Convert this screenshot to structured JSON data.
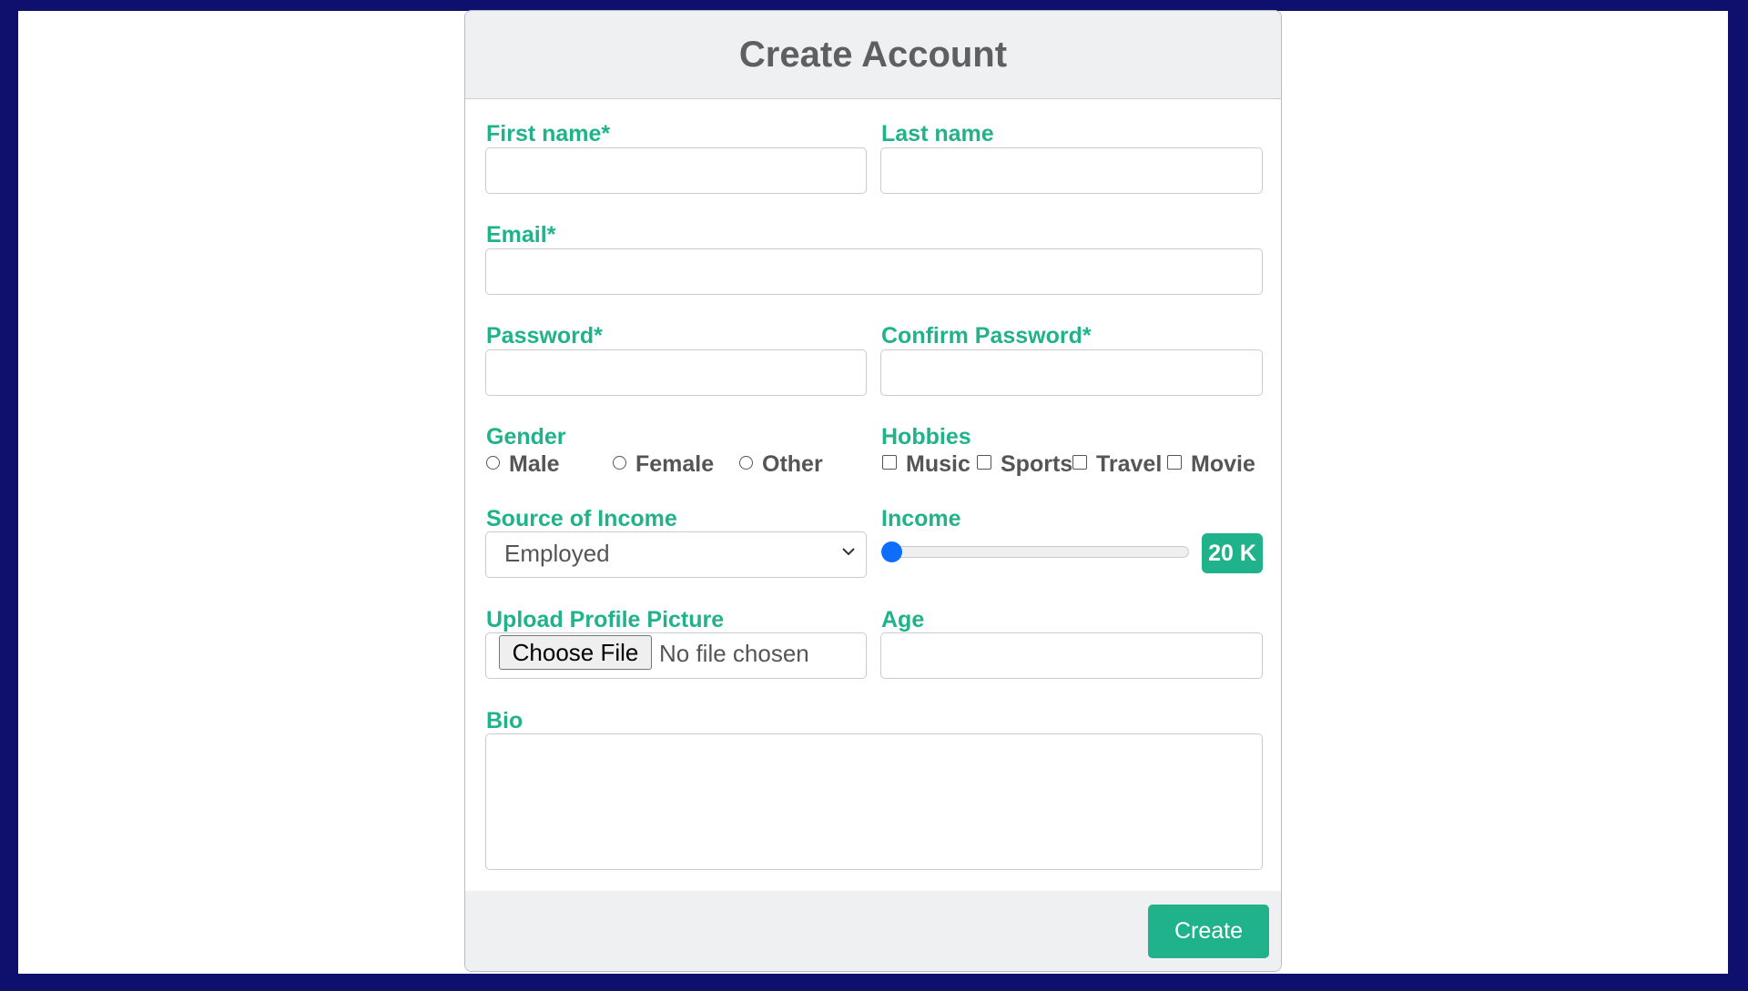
{
  "form": {
    "title": "Create Account",
    "first_name": {
      "label": "First name*",
      "value": ""
    },
    "last_name": {
      "label": "Last name",
      "value": ""
    },
    "email": {
      "label": "Email*",
      "value": ""
    },
    "password": {
      "label": "Password*",
      "value": ""
    },
    "confirm_password": {
      "label": "Confirm Password*",
      "value": ""
    },
    "gender": {
      "label": "Gender",
      "options": [
        "Male",
        "Female",
        "Other"
      ],
      "selected": null
    },
    "hobbies": {
      "label": "Hobbies",
      "options": [
        "Music",
        "Sports",
        "Travel",
        "Movie"
      ],
      "checked": []
    },
    "source_of_income": {
      "label": "Source of Income",
      "selected": "Employed"
    },
    "income": {
      "label": "Income",
      "value": 20,
      "badge": "20 K"
    },
    "upload": {
      "label": "Upload Profile Picture",
      "button": "Choose File",
      "status": "No file chosen"
    },
    "age": {
      "label": "Age",
      "value": ""
    },
    "bio": {
      "label": "Bio",
      "value": ""
    },
    "submit_label": "Create"
  },
  "colors": {
    "accent": "#20b38b",
    "frame": "#0f0f6e",
    "slider_thumb": "#0d6efd"
  }
}
